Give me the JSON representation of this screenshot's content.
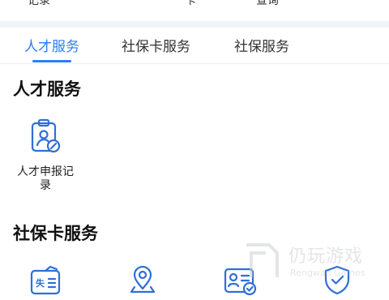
{
  "top_strip": {
    "items": [
      "记录",
      "卡",
      "查询"
    ]
  },
  "tabs": [
    {
      "label": "人才服务",
      "active": true
    },
    {
      "label": "社保卡服务",
      "active": false
    },
    {
      "label": "社保服务",
      "active": false
    }
  ],
  "sections": {
    "talent": {
      "title": "人才服务",
      "items": [
        {
          "label": "人才申报记录",
          "icon": "clipboard-user-icon"
        }
      ]
    },
    "social_card": {
      "title": "社保卡服务",
      "items": [
        {
          "label": "",
          "icon": "card-lost-icon"
        },
        {
          "label": "",
          "icon": "location-pin-icon"
        },
        {
          "label": "",
          "icon": "id-card-check-icon"
        },
        {
          "label": "",
          "icon": "shield-check-icon"
        }
      ]
    }
  },
  "watermark": {
    "text": "仍玩游戏",
    "sub": "Rengwan Games"
  },
  "colors": {
    "accent": "#2f7cf6",
    "icon": "#2f6fd6",
    "text": "#1a1a1a"
  }
}
